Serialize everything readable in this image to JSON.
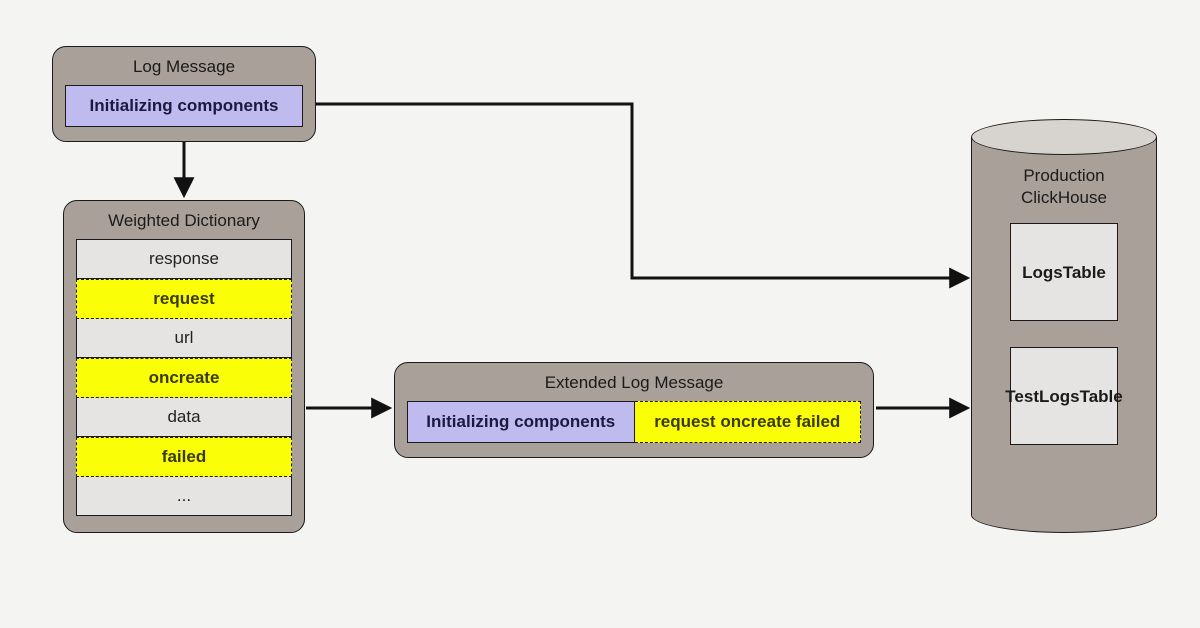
{
  "logMessage": {
    "title": "Log Message",
    "value": "Initializing components"
  },
  "dictionary": {
    "title": "Weighted Dictionary",
    "rows": [
      {
        "text": "response",
        "hi": false
      },
      {
        "text": "request",
        "hi": true
      },
      {
        "text": "url",
        "hi": false
      },
      {
        "text": "oncreate",
        "hi": true
      },
      {
        "text": "data",
        "hi": false
      },
      {
        "text": "failed",
        "hi": true
      },
      {
        "text": "...",
        "hi": false
      }
    ]
  },
  "extended": {
    "title": "Extended Log Message",
    "original": "Initializing components",
    "appended": "request oncreate failed"
  },
  "database": {
    "title": "Production ClickHouse",
    "tables": [
      {
        "name": "Logs Table"
      },
      {
        "name": "Test Logs Table"
      }
    ]
  }
}
